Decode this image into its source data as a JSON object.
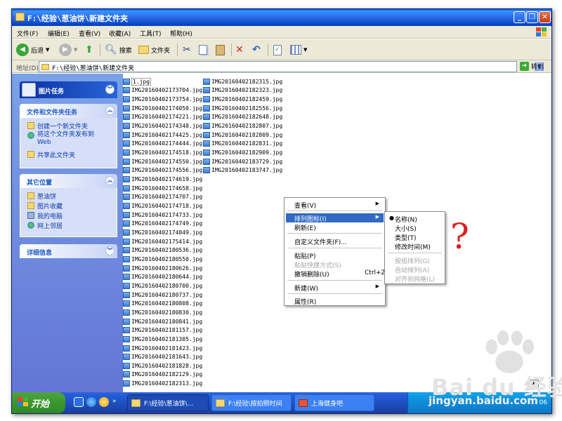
{
  "window": {
    "title": "F:\\经验\\葱油饼\\新建文件夹",
    "minimize": "_",
    "maximize": "❐",
    "close": "✕"
  },
  "menu": [
    "文件(F)",
    "编辑(E)",
    "查看(V)",
    "收藏(A)",
    "工具(T)",
    "帮助(H)"
  ],
  "toolbar": {
    "back": "后退",
    "search": "搜索",
    "folders": "文件夹"
  },
  "address": {
    "label": "地址(D)",
    "value": "F:\\经验\\葱油饼\\新建文件夹",
    "go": "转到"
  },
  "taskpane": {
    "picture_tasks": "图片任务",
    "file_folder_tasks": {
      "title": "文件和文件夹任务",
      "items": [
        "创建一个新文件夹",
        "将这个文件夹发布到",
        "Web",
        "共享此文件夹"
      ]
    },
    "other_places": {
      "title": "其它位置",
      "items": [
        "葱油饼",
        "图片收藏",
        "我的电脑",
        "网上邻居"
      ]
    },
    "details": "详细信息"
  },
  "files": {
    "col1": [
      "1.jpg",
      "IMG20160402173704.jpg",
      "IMG20160402173754.jpg",
      "IMG20160402174050.jpg",
      "IMG20160402174221.jpg",
      "IMG20160402174348.jpg",
      "IMG20160402174425.jpg",
      "IMG20160402174444.jpg",
      "IMG20160402174518.jpg",
      "IMG20160402174550.jpg",
      "IMG20160402174556.jpg",
      "IMG20160402174619.jpg",
      "IMG20160402174658.jpg",
      "IMG20160402174707.jpg",
      "IMG20160402174718.jpg",
      "IMG20160402174733.jpg",
      "IMG20160402174749.jpg",
      "IMG20160402174849.jpg",
      "IMG20160402175414.jpg",
      "IMG20160402180536.jpg",
      "IMG20160402180550.jpg",
      "IMG20160402180626.jpg",
      "IMG20160402180644.jpg",
      "IMG20160402180700.jpg",
      "IMG20160402180737.jpg",
      "IMG20160402180808.jpg",
      "IMG20160402180830.jpg",
      "IMG20160402180841.jpg",
      "IMG20160402181157.jpg",
      "IMG20160402181305.jpg",
      "IMG20160402181423.jpg",
      "IMG20160402181643.jpg",
      "IMG20160402181828.jpg",
      "IMG20160402182129.jpg",
      "IMG20160402182313.jpg"
    ],
    "col2": [
      "IMG20160402182315.jpg",
      "IMG20160402182323.jpg",
      "IMG20160402182459.jpg",
      "IMG20160402182556.jpg",
      "IMG20160402182648.jpg",
      "IMG20160402182807.jpg",
      "IMG20160402182809.jpg",
      "IMG20160402182831.jpg",
      "IMG20160402182909.jpg",
      "IMG20160402183729.jpg",
      "IMG20160402183747.jpg"
    ]
  },
  "context_menu": {
    "view": "查看(V)",
    "arrange": "排列图标(I)",
    "refresh": "刷新(E)",
    "customize": "自定义文件夹(F)...",
    "paste": "粘贴(P)",
    "paste_shortcut": "粘贴快捷方式(S)",
    "undo_delete": "撤销删除(U)",
    "undo_shortcut": "Ctrl+Z",
    "new": "新建(W)",
    "properties": "属性(R)"
  },
  "arrange_submenu": {
    "name": "名称(N)",
    "size": "大小(S)",
    "type": "类型(T)",
    "modified": "修改时间(M)",
    "group": "按组排列(G)",
    "auto": "自动排列(A)",
    "align": "对齐到网格(L)"
  },
  "annotation": "?",
  "taskbar": {
    "start": "开始",
    "tasks": [
      "F:\\经验\\葱油饼\\...",
      "F:\\经验\\按拍照时间",
      "上海健身吧"
    ],
    "clock": "06",
    "help": "?"
  },
  "watermark": {
    "line1": "Bai du 经验",
    "line2": "jingyan.baidu.com"
  },
  "colors": {
    "titlebar": "#0a5ae8",
    "taskpane": "#6f8ee0",
    "highlight": "#316ac5",
    "start": "#3c9a32"
  }
}
